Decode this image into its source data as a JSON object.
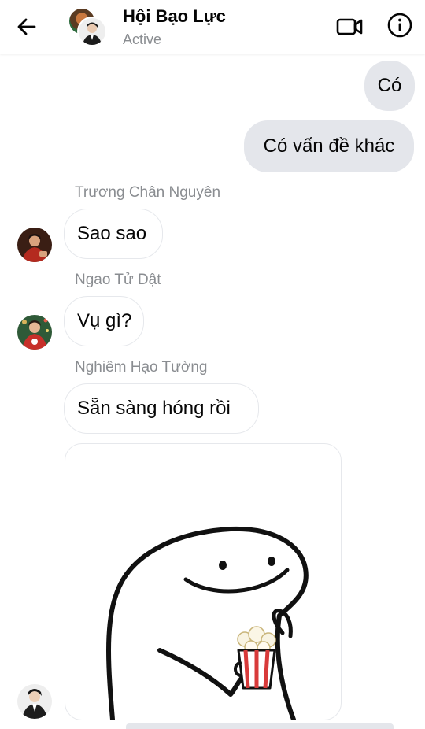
{
  "header": {
    "title": "Hội Bạo Lực",
    "status": "Active",
    "back_icon": "arrow-left-icon",
    "video_icon": "video-camera-icon",
    "info_icon": "info-icon",
    "accent_color": "#050505"
  },
  "messages": {
    "out_1": "Có",
    "out_2": "Có vấn đề khác",
    "sender_1": "Trương Chân Nguyên",
    "in_1": "Sao sao",
    "sender_2": "Ngao Tử Dật",
    "in_2": "Vụ gì?",
    "sender_3": "Nghiêm Hạo Tường",
    "in_3": "Sẵn sàng hóng rồi",
    "sticker": "popcorn-meme-sticker"
  },
  "colors": {
    "outgoing_bubble": "#e4e6eb",
    "incoming_border": "#e6e8ec",
    "muted_text": "#8a8d91"
  }
}
